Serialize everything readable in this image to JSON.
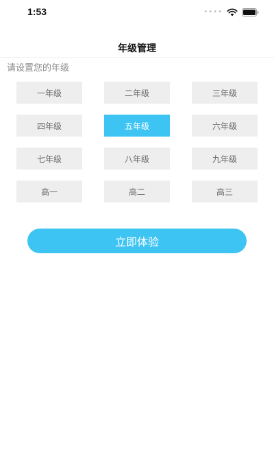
{
  "status_bar": {
    "time": "1:53",
    "signal_dots": "••••",
    "icons": [
      "signal-dots-icon",
      "wifi-icon",
      "battery-icon"
    ]
  },
  "nav": {
    "title": "年级管理"
  },
  "hint": "请设置您的年级",
  "grades": [
    "一年级",
    "二年级",
    "三年级",
    "四年级",
    "五年级",
    "六年级",
    "七年级",
    "八年级",
    "九年级",
    "高一",
    "高二",
    "高三"
  ],
  "selected_grade": "五年级",
  "cta_label": "立即体验",
  "colors": {
    "accent": "#3ec4f2",
    "grade_bg": "#eeeeee",
    "grade_text": "#6b6b6b",
    "hint_text": "#8a8a8a"
  }
}
